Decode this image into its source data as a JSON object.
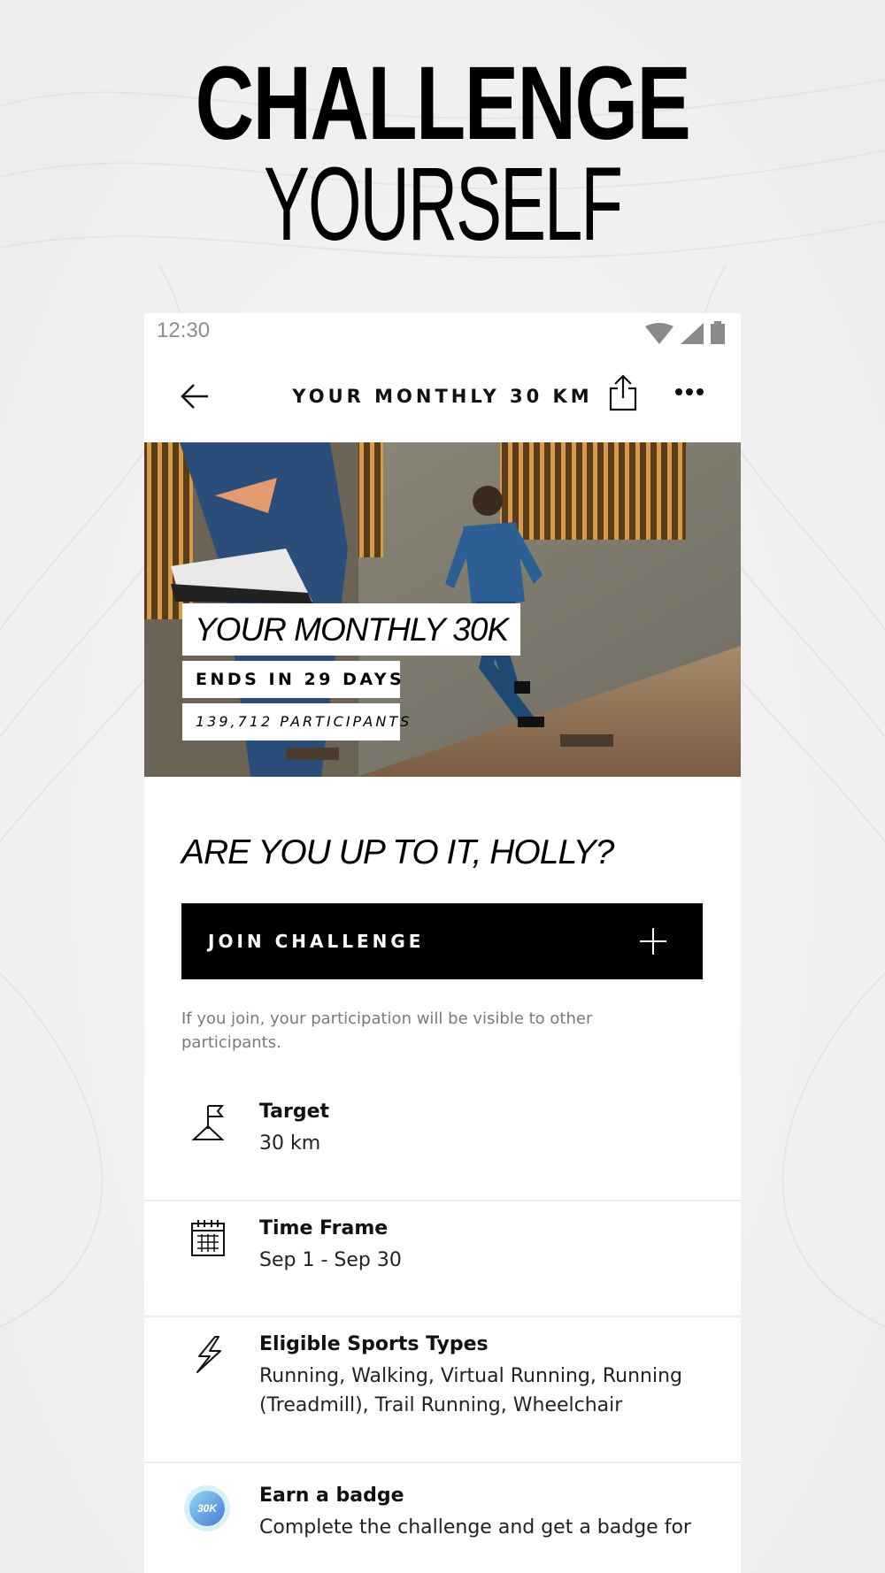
{
  "headline": {
    "line1": "CHALLENGE",
    "line2": "YOURSELF"
  },
  "status_bar": {
    "time": "12:30",
    "icons": [
      "wifi-icon",
      "signal-icon",
      "battery-icon"
    ]
  },
  "app_bar": {
    "title": "YOUR MONTHLY 30 KM",
    "icons": [
      "back-arrow-icon",
      "share-icon",
      "more-icon"
    ]
  },
  "hero": {
    "title": "YOUR MONTHLY 30K",
    "ends": "ENDS IN 29 DAYS",
    "participants": "139,712 PARTICIPANTS"
  },
  "question": "ARE YOU UP TO IT, HOLLY?",
  "join_button": {
    "label": "JOIN CHALLENGE",
    "icon": "plus-icon"
  },
  "disclaimer": "If you join, your participation will be visible to other participants.",
  "details": [
    {
      "icon": "flag-icon",
      "heading": "Target",
      "value": "30 km"
    },
    {
      "icon": "calendar-icon",
      "heading": "Time Frame",
      "value": "Sep 1 - Sep 30"
    },
    {
      "icon": "lightning-icon",
      "heading": "Eligible Sports Types",
      "value": "Running, Walking, Virtual Running, Running (Treadmill), Trail Running, Wheelchair"
    },
    {
      "icon": "badge-icon",
      "heading": "Earn a badge",
      "value": "Complete the challenge and get a badge for",
      "badge_text": "30K"
    }
  ]
}
